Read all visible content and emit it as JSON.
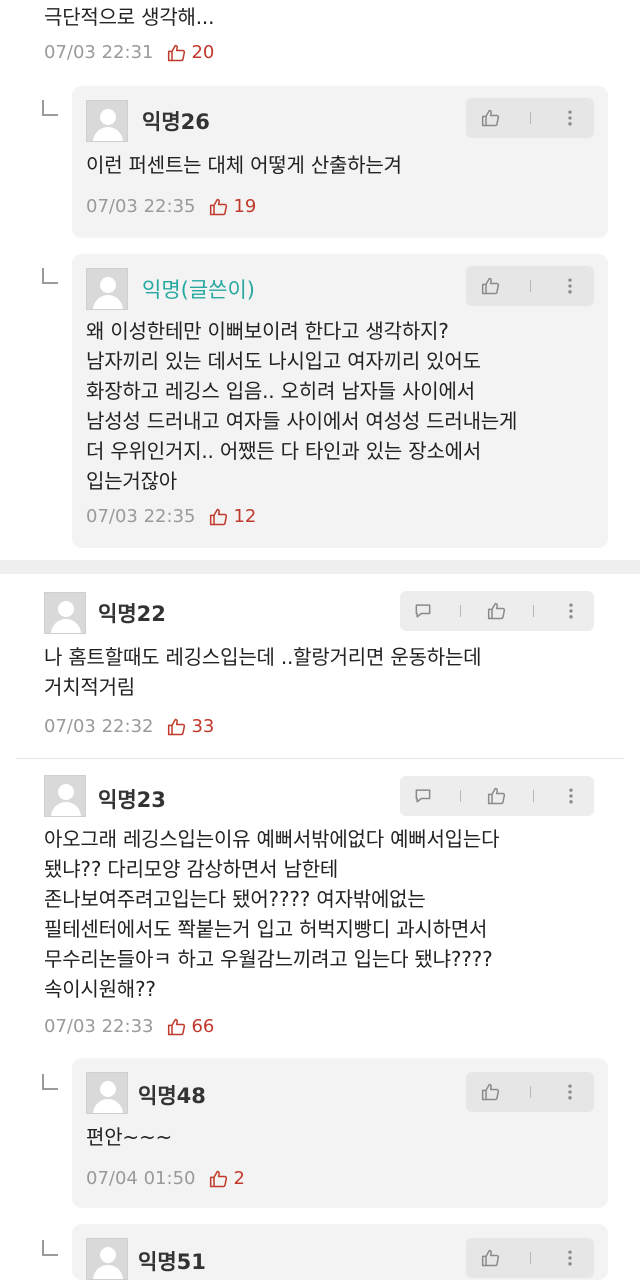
{
  "comments": [
    {
      "text": "극단적으로 생각해...",
      "date": "07/03 22:31",
      "likes": "20"
    },
    {
      "name": "익명26",
      "text": "이런 퍼센트는 대체 어떻게 산출하는겨",
      "date": "07/03 22:35",
      "likes": "19"
    },
    {
      "name": "익명(글쓴이)",
      "text": "왜 이성한테만 이뻐보이려 한다고 생각하지?\n남자끼리 있는 데서도 나시입고 여자끼리 있어도\n화장하고 레깅스 입음.. 오히려 남자들 사이에서\n남성성 드러내고 여자들 사이에서 여성성 드러내는게\n더 우위인거지.. 어쨌든 다 타인과 있는 장소에서\n입는거잖아",
      "date": "07/03 22:35",
      "likes": "12"
    },
    {
      "name": "익명22",
      "text": "나 홈트할때도 레깅스입는데 ..할랑거리면 운동하는데\n거치적거림",
      "date": "07/03 22:32",
      "likes": "33"
    },
    {
      "name": "익명23",
      "text": "아오그래 레깅스입는이유 예뻐서밖에없다 예뻐서입는다\n됐냐?? 다리모양 감상하면서 남한테\n존나보여주려고입는다 됐어???? 여자밖에없는\n필테센터에서도 쫙붙는거 입고 허벅지빵디 과시하면서\n무수리논들아ㅋ 하고 우월감느끼려고 입는다 됐냐????\n속이시원해??",
      "date": "07/03 22:33",
      "likes": "66"
    },
    {
      "name": "익명48",
      "text": "편안~~~",
      "date": "07/04 01:50",
      "likes": "2"
    },
    {
      "name": "익명51"
    }
  ]
}
